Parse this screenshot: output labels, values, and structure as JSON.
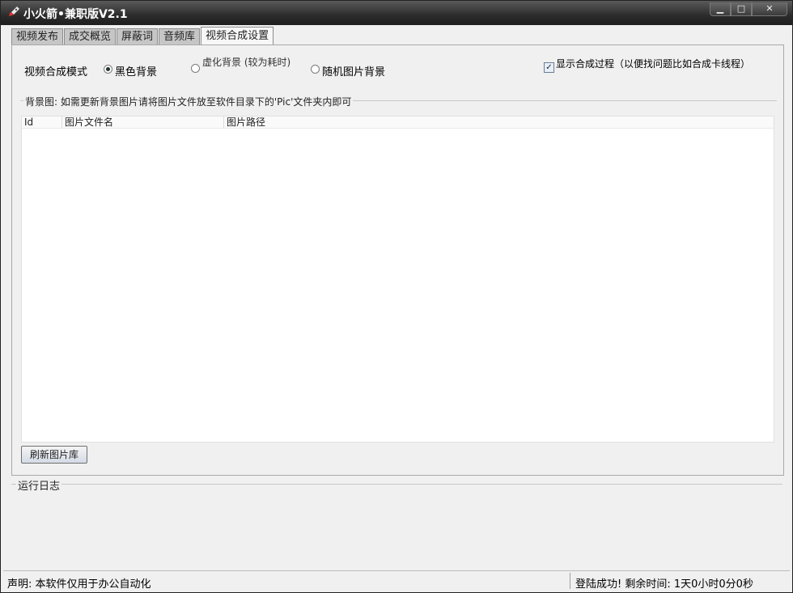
{
  "window": {
    "title": "小火箭•兼职版V2.1"
  },
  "tabs": [
    "视频发布",
    "成交概览",
    "屏蔽词",
    "音频库",
    "视频合成设置"
  ],
  "mode": {
    "label": "视频合成模式",
    "options": [
      "黑色背景",
      "虚化背景 (较为耗时)",
      "随机图片背景"
    ],
    "selected": "黑色背景"
  },
  "show_process": {
    "label": "显示合成过程（以便找问题比如合成卡线程）",
    "checked": true
  },
  "bg_group": {
    "legend": "背景图: 如需更新背景图片请将图片文件放至软件目录下的'Pic'文件夹内即可",
    "columns": [
      "Id",
      "图片文件名",
      "图片路径"
    ],
    "refresh_label": "刷新图片库"
  },
  "log": {
    "legend": "运行日志"
  },
  "status": {
    "left": "声明: 本软件仅用于办公自动化",
    "right": "登陆成功! 剩余时间: 1天0小时0分0秒"
  }
}
